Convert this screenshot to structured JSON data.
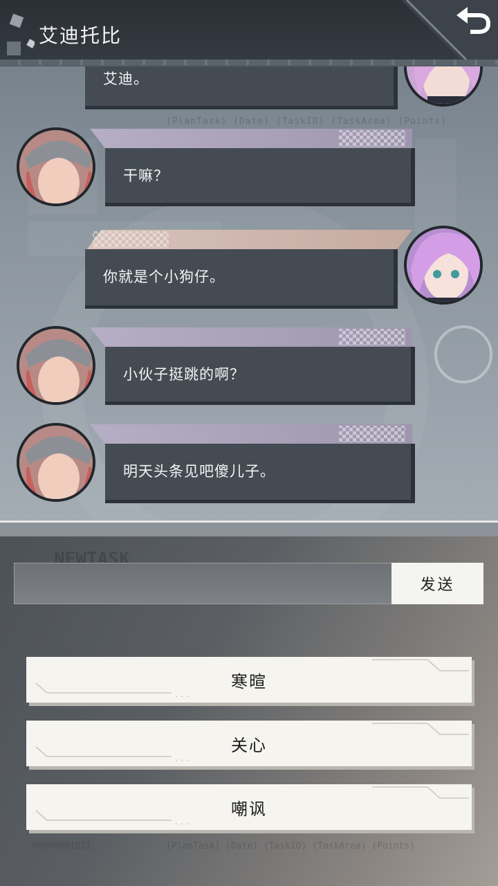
{
  "header": {
    "title": "艾迪托比"
  },
  "background": {
    "line1": "(PlanTask) (Date) (TaskID) (TaskArea) (Points)",
    "line2": "NEWTASK",
    "line3": "00000001011",
    "line4": "(PlanTask) (Date) (TaskID) (TaskArea) (Points)"
  },
  "messages": [
    {
      "side": "right",
      "text": "艾迪。"
    },
    {
      "side": "left",
      "text": "干嘛？"
    },
    {
      "side": "right",
      "text": "你就是个小狗仔。"
    },
    {
      "side": "left",
      "text": "小伙子挺跳的啊？"
    },
    {
      "side": "left",
      "text": "明天头条见吧傻儿子。"
    }
  ],
  "input": {
    "value": "",
    "send_label": "发送"
  },
  "options": [
    {
      "label": "寒暄"
    },
    {
      "label": "关心"
    },
    {
      "label": "嘲讽"
    }
  ]
}
